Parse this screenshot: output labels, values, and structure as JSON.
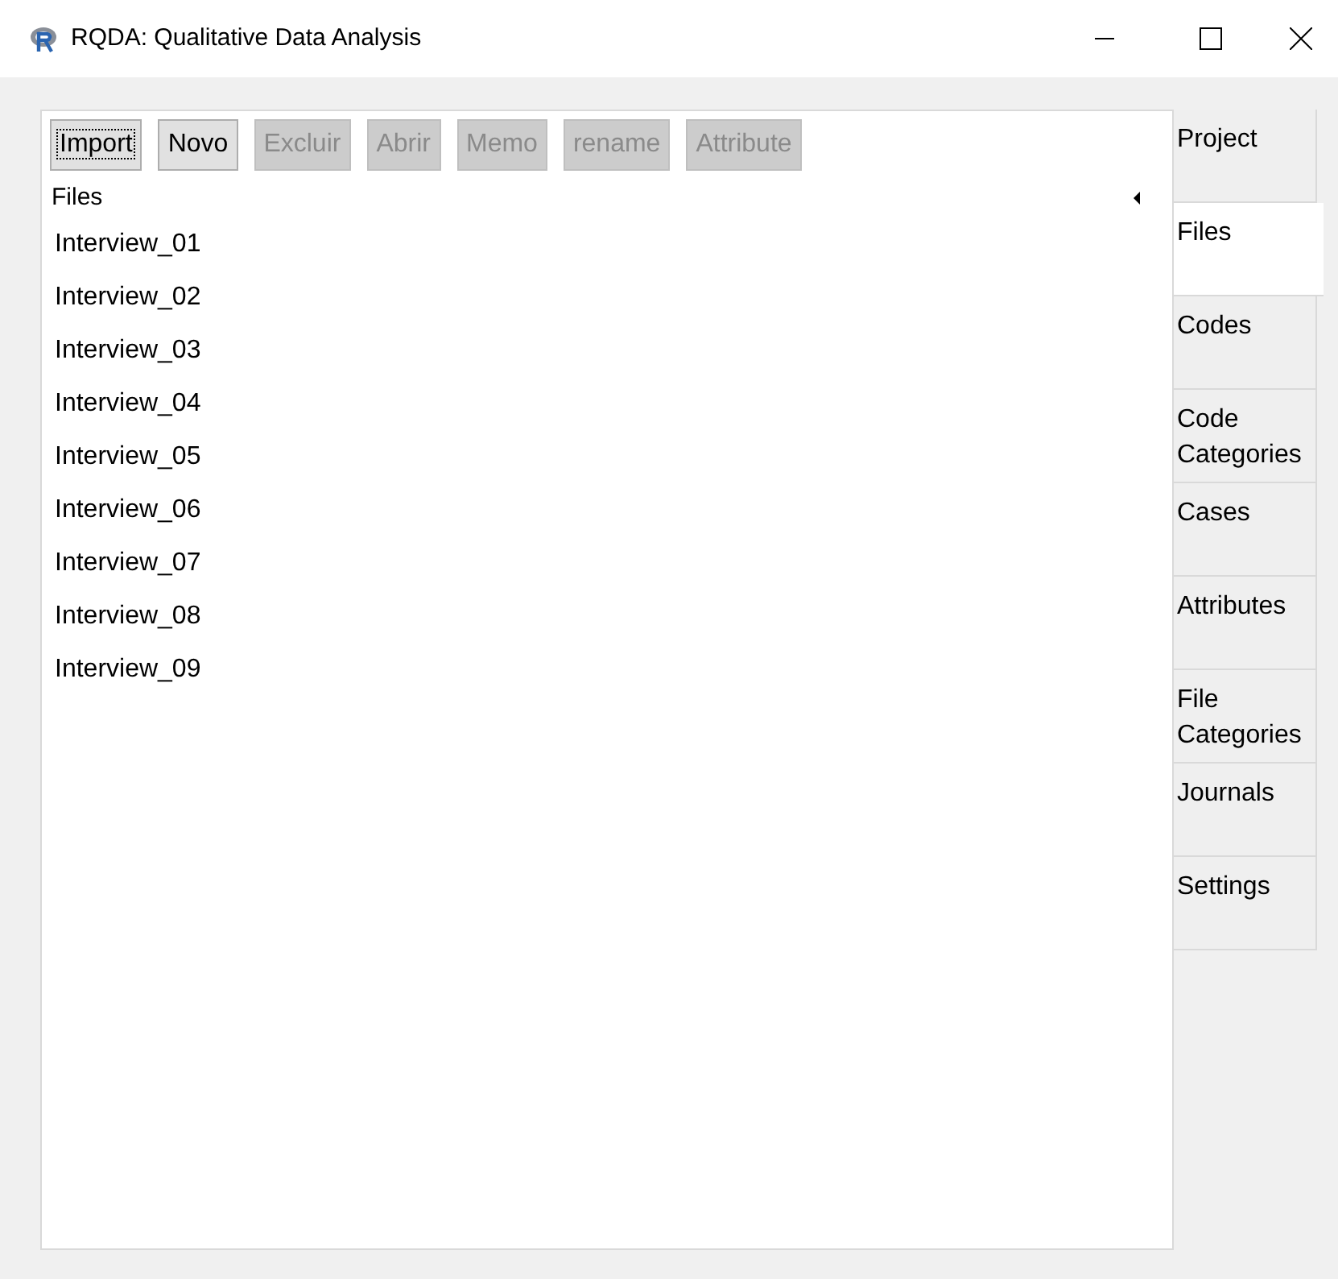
{
  "window": {
    "title": "RQDA: Qualitative Data Analysis"
  },
  "toolbar": [
    {
      "label": "Import",
      "disabled": false,
      "focused": true
    },
    {
      "label": "Novo",
      "disabled": false,
      "focused": false
    },
    {
      "label": "Excluir",
      "disabled": true,
      "focused": false
    },
    {
      "label": "Abrir",
      "disabled": true,
      "focused": false
    },
    {
      "label": "Memo",
      "disabled": true,
      "focused": false
    },
    {
      "label": "rename",
      "disabled": true,
      "focused": false
    },
    {
      "label": "Attribute",
      "disabled": true,
      "focused": false
    }
  ],
  "list": {
    "header": "Files",
    "items": [
      "Interview_01",
      "Interview_02",
      "Interview_03",
      "Interview_04",
      "Interview_05",
      "Interview_06",
      "Interview_07",
      "Interview_08",
      "Interview_09"
    ]
  },
  "tabs": [
    {
      "label": "Project",
      "selected": false
    },
    {
      "label": "Files",
      "selected": true
    },
    {
      "label": "Codes",
      "selected": false
    },
    {
      "label": "Code Categories",
      "selected": false
    },
    {
      "label": "Cases",
      "selected": false
    },
    {
      "label": "Attributes",
      "selected": false
    },
    {
      "label": "File Categories",
      "selected": false
    },
    {
      "label": "Journals",
      "selected": false
    },
    {
      "label": "Settings",
      "selected": false
    }
  ]
}
